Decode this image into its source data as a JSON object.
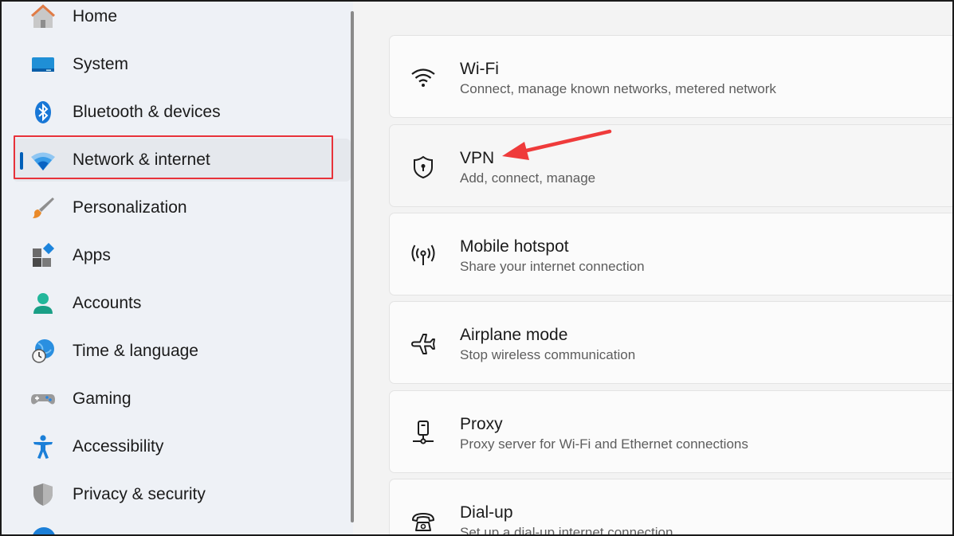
{
  "sidebar": {
    "items": [
      {
        "label": "Home",
        "icon": "home-icon"
      },
      {
        "label": "System",
        "icon": "system-icon"
      },
      {
        "label": "Bluetooth & devices",
        "icon": "bluetooth-icon"
      },
      {
        "label": "Network & internet",
        "icon": "wifi-icon",
        "selected": true
      },
      {
        "label": "Personalization",
        "icon": "brush-icon"
      },
      {
        "label": "Apps",
        "icon": "apps-icon"
      },
      {
        "label": "Accounts",
        "icon": "account-icon"
      },
      {
        "label": "Time & language",
        "icon": "clock-globe-icon"
      },
      {
        "label": "Gaming",
        "icon": "gamepad-icon"
      },
      {
        "label": "Accessibility",
        "icon": "accessibility-icon"
      },
      {
        "label": "Privacy & security",
        "icon": "shield-icon"
      }
    ]
  },
  "content": {
    "cards": [
      {
        "title": "Wi-Fi",
        "subtitle": "Connect, manage known networks, metered network",
        "icon": "wifi-icon"
      },
      {
        "title": "VPN",
        "subtitle": "Add, connect, manage",
        "icon": "vpn-shield-icon"
      },
      {
        "title": "Mobile hotspot",
        "subtitle": "Share your internet connection",
        "icon": "hotspot-icon"
      },
      {
        "title": "Airplane mode",
        "subtitle": "Stop wireless communication",
        "icon": "airplane-icon"
      },
      {
        "title": "Proxy",
        "subtitle": "Proxy server for Wi-Fi and Ethernet connections",
        "icon": "proxy-icon"
      },
      {
        "title": "Dial-up",
        "subtitle": "Set up a dial-up internet connection",
        "icon": "dialup-icon"
      }
    ]
  },
  "colors": {
    "accent": "#005fb8",
    "highlight": "#e8323a",
    "annotation_arrow": "#ef3b3b"
  }
}
